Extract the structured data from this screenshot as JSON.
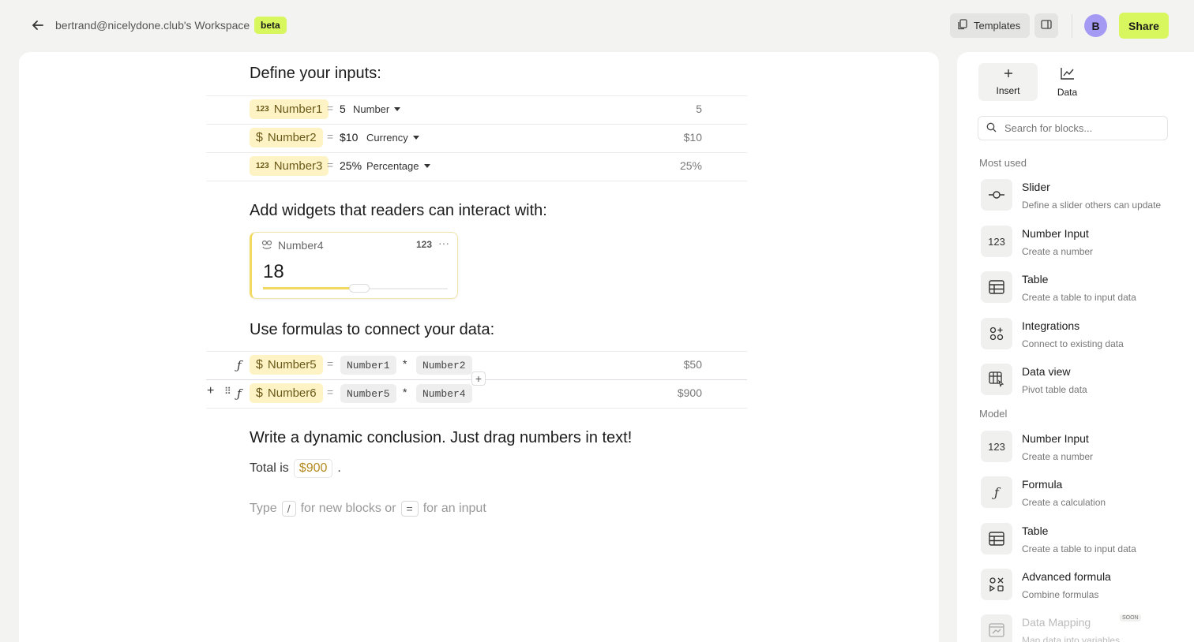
{
  "topbar": {
    "workspace_title": "bertrand@nicelydone.club's Workspace",
    "badge": "beta",
    "templates_label": "Templates",
    "avatar_initial": "B",
    "share_label": "Share"
  },
  "doc": {
    "heading_inputs": "Define your inputs:",
    "inputs": [
      {
        "name": "Number1",
        "tag": "123",
        "value": "5",
        "type": "Number",
        "result": "5"
      },
      {
        "name": "Number2",
        "tag": "$",
        "value": "$10",
        "type": "Currency",
        "result": "$10"
      },
      {
        "name": "Number3",
        "tag": "123",
        "value": "25%",
        "type": "Percentage",
        "result": "25%"
      }
    ],
    "heading_widgets": "Add widgets that readers can interact with:",
    "widget": {
      "name": "Number4",
      "badge": "123",
      "value": "18",
      "slider_fraction": 0.52
    },
    "heading_formulas": "Use formulas to connect your data:",
    "formulas": [
      {
        "name": "Number5",
        "a": "Number1",
        "b": "Number2",
        "op": "*",
        "result": "$50"
      },
      {
        "name": "Number6",
        "a": "Number5",
        "b": "Number4",
        "op": "*",
        "result": "$900"
      }
    ],
    "heading_conclusion": "Write a dynamic conclusion. Just drag numbers in text!",
    "total_prefix": "Total is",
    "total_value": "$900",
    "total_suffix": ".",
    "hint": {
      "type": "Type",
      "slash": "/",
      "mid": "for new blocks or",
      "eq": "=",
      "end": "for an input"
    },
    "equals": "="
  },
  "panel": {
    "tabs": [
      {
        "label": "Insert",
        "icon": "plus-icon"
      },
      {
        "label": "Data",
        "icon": "chart-icon"
      }
    ],
    "search_placeholder": "Search for blocks...",
    "most_used_label": "Most used",
    "most_used": [
      {
        "title": "Slider",
        "desc": "Define a slider others can update",
        "icon": "slider-icon"
      },
      {
        "title": "Number Input",
        "desc": "Create a number",
        "icon": "number-icon"
      },
      {
        "title": "Table",
        "desc": "Create a table to input data",
        "icon": "table-icon"
      },
      {
        "title": "Integrations",
        "desc": "Connect to existing data",
        "icon": "integrations-icon"
      },
      {
        "title": "Data view",
        "desc": "Pivot table data",
        "icon": "data-view-icon"
      }
    ],
    "model_label": "Model",
    "model": [
      {
        "title": "Number Input",
        "desc": "Create a number",
        "icon": "number-icon"
      },
      {
        "title": "Formula",
        "desc": "Create a calculation",
        "icon": "formula-icon"
      },
      {
        "title": "Table",
        "desc": "Create a table to input data",
        "icon": "table-icon"
      },
      {
        "title": "Advanced formula",
        "desc": "Combine formulas",
        "icon": "advanced-formula-icon"
      },
      {
        "title": "Data Mapping",
        "desc": "Map data into variables",
        "icon": "data-mapping-icon",
        "badge": "SOON"
      }
    ]
  }
}
